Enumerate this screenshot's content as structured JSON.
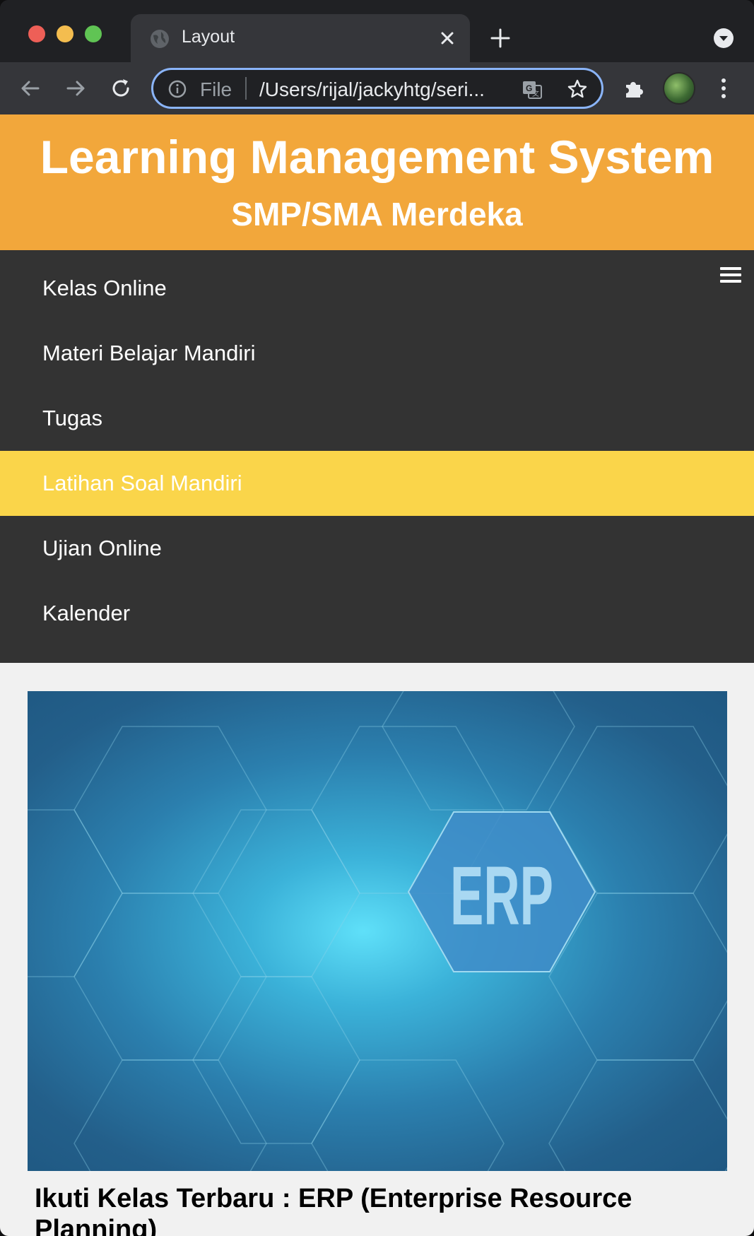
{
  "browser": {
    "tab_title": "Layout",
    "omnibox_scheme": "File",
    "omnibox_url": "/Users/rijal/jackyhtg/seri...",
    "accent": "#8ab4f8"
  },
  "site": {
    "title": "Learning Management System",
    "subtitle": "SMP/SMA Merdeka",
    "header_color": "#f2a73b"
  },
  "nav": {
    "items": [
      {
        "label": "Kelas Online"
      },
      {
        "label": "Materi Belajar Mandiri"
      },
      {
        "label": "Tugas"
      },
      {
        "label": "Latihan Soal Mandiri",
        "active": true
      },
      {
        "label": "Ujian Online"
      },
      {
        "label": "Kalender"
      }
    ],
    "active_color": "#fad54a",
    "background": "#333333"
  },
  "featured": {
    "image_label": "ERP",
    "title": "Ikuti Kelas Terbaru : ERP (Enterprise Resource Planning)"
  }
}
